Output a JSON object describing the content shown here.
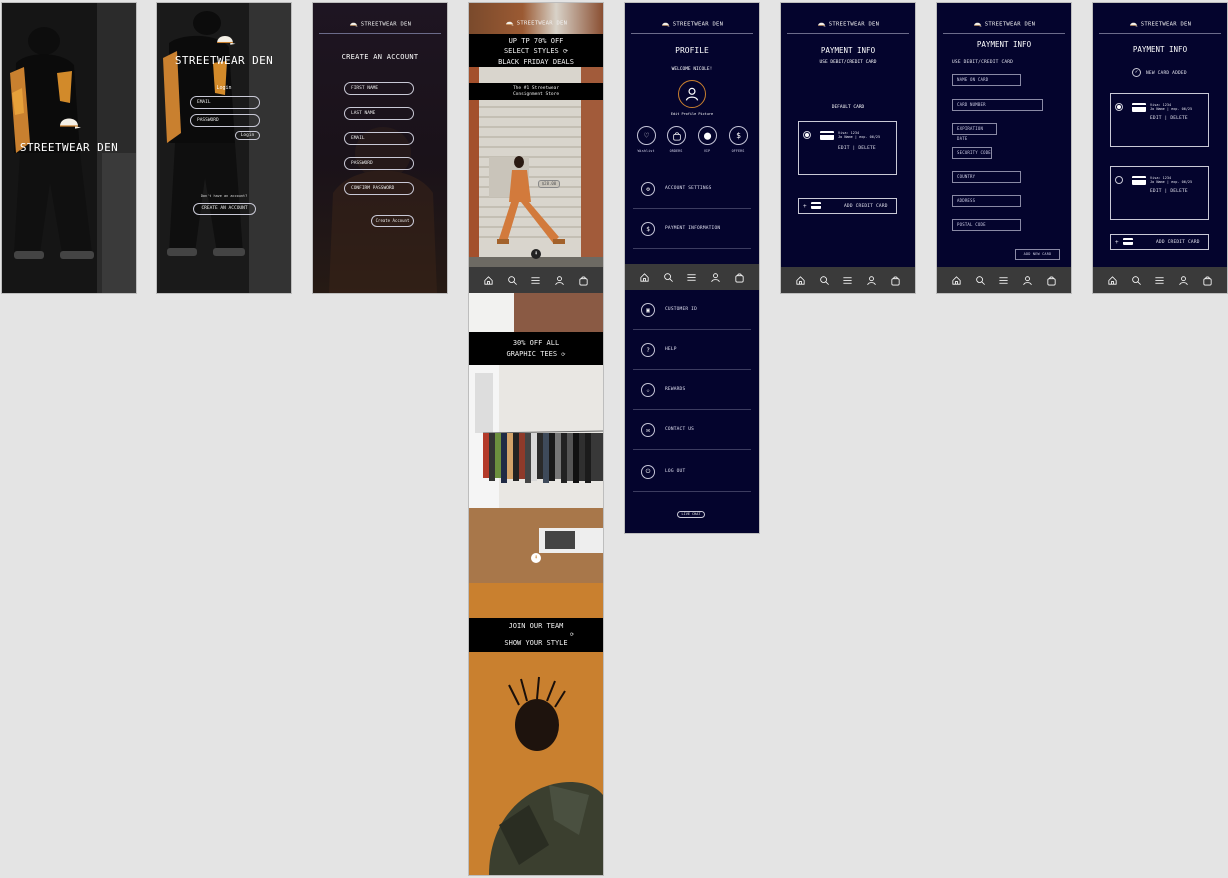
{
  "brand": "STREETWEAR DEN",
  "brand_small": "STREETWEAR DEN",
  "splash": {
    "title": "STREETWEAR DEN"
  },
  "login": {
    "title": "STREETWEAR DEN",
    "heading": "Login",
    "email_placeholder": "EMAIL",
    "password_placeholder": "PASSWORD",
    "login_button": "Login",
    "no_account": "Don't have an account?",
    "create_button": "CREATE AN ACCOUNT"
  },
  "signup": {
    "title": "CREATE AN ACCOUNT",
    "fields": [
      "FIRST NAME",
      "LAST NAME",
      "EMAIL",
      "PASSWORD",
      "CONFIRM PASSWORD"
    ],
    "submit": "Create Account"
  },
  "home": {
    "promo1_line1": "UP TP 70% OFF",
    "promo1_line2": "SELECT STYLES",
    "promo1_line3": "BLACK FRIDAY DEALS",
    "tagline_line1": "The #1 Streetwear",
    "tagline_line2": "Consignment Store",
    "price_tag": "$28.00",
    "promo2_line1": "30% OFF ALL",
    "promo2_line2": "GRAPHIC TEES",
    "promo3_line1": "JOIN OUR TEAM",
    "promo3_line2": "SHOW YOUR STYLE"
  },
  "profile": {
    "title": "PROFILE",
    "welcome": "WELCOME NICOLE!",
    "edit_picture": "Edit Profile Picture",
    "quick": [
      {
        "label": "Wishlist",
        "icon": "heart-icon"
      },
      {
        "label": "ORDERS",
        "icon": "bag-icon"
      },
      {
        "label": "VIP",
        "icon": "vip-icon"
      },
      {
        "label": "OFFERS",
        "icon": "dollar-icon"
      }
    ],
    "menu": [
      {
        "label": "ACCOUNT SETTINGS",
        "icon": "settings-icon",
        "glyph": "⚙"
      },
      {
        "label": "PAYMENT INFORMATION",
        "icon": "dollar-icon",
        "glyph": "$"
      },
      {
        "label": "CUSTOMER ID",
        "icon": "id-icon",
        "glyph": "▣"
      },
      {
        "label": "HELP",
        "icon": "question-icon",
        "glyph": "?"
      },
      {
        "label": "REWARDS",
        "icon": "star-icon",
        "glyph": "☆"
      },
      {
        "label": "CONTACT US",
        "icon": "chat-icon",
        "glyph": "✉"
      },
      {
        "label": "LOG OUT",
        "icon": "logout-icon",
        "glyph": "⏻"
      }
    ],
    "live_chat": "LIVE CHAT"
  },
  "payment1": {
    "title": "PAYMENT INFO",
    "subtitle": "USE DEBIT/CREDIT CARD",
    "default_card": "DEFAULT CARD",
    "card_line1": "Visa: 1234",
    "card_line2": "Jo Name | exp. 06/25",
    "edit_delete": "EDIT | DELETE",
    "add_card": "ADD CREDIT CARD"
  },
  "payment2": {
    "title": "PAYMENT INFO",
    "subtitle": "USE DEBIT/CREDIT CARD",
    "fields": [
      "NAME ON CARD",
      "CARD NUMBER",
      "EXPIRATION DATE",
      "SECURITY CODE",
      "COUNTRY",
      "ADDRESS",
      "POSTAL CODE"
    ],
    "add_new": "ADD NEW CARD"
  },
  "payment3": {
    "title": "PAYMENT INFO",
    "added": "NEW CARD ADDED",
    "card_line1": "Visa: 1234",
    "card_line2": "Jo Name | exp. 06/25",
    "edit_delete": "EDIT | DELETE",
    "add_card": "ADD CREDIT CARD"
  },
  "colors": {
    "navy": "#04042d",
    "tabbar": "#3a3a3a",
    "orange": "#c9802f"
  }
}
